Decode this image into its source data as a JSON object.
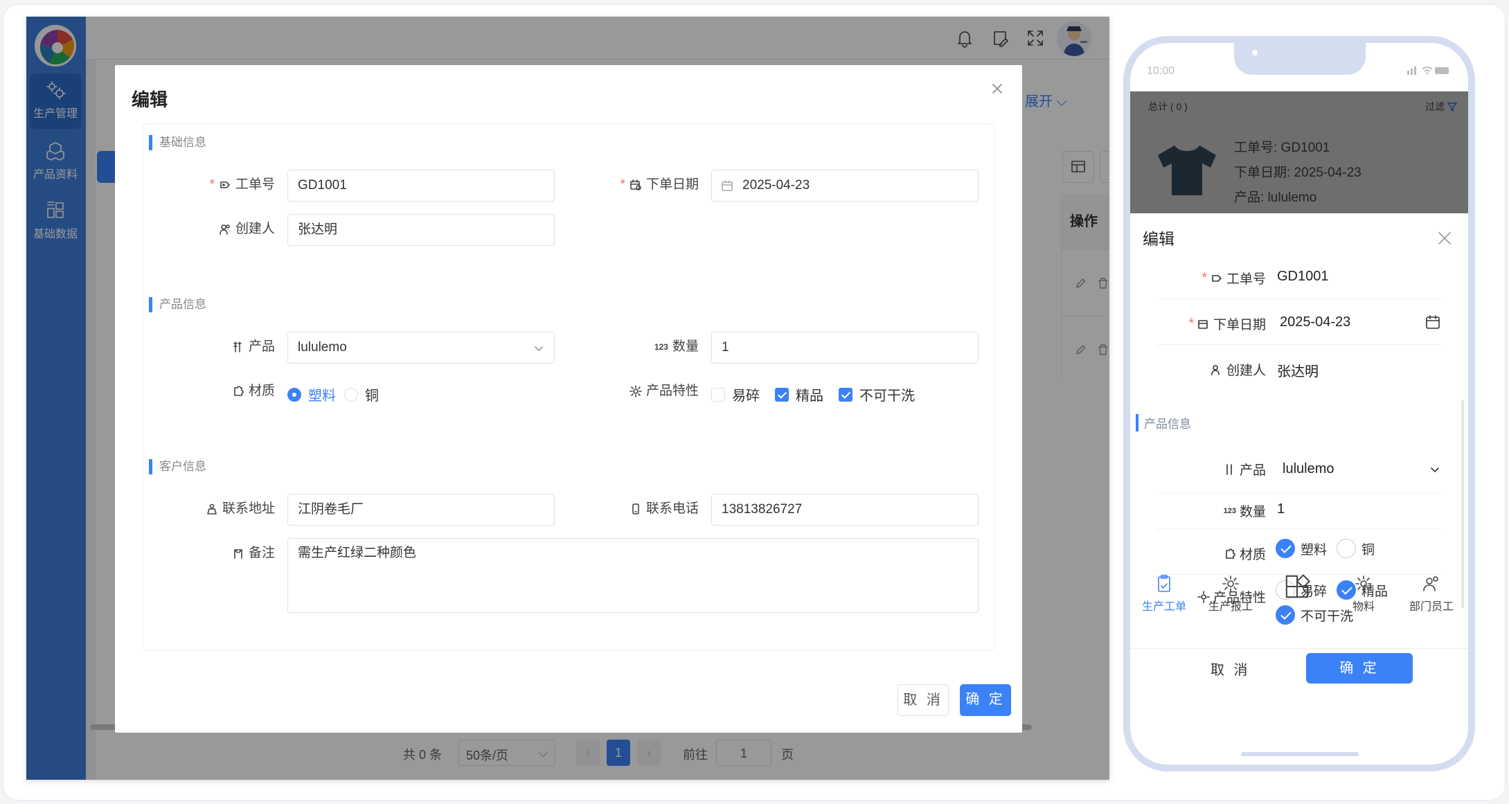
{
  "sidebar": {
    "items": [
      {
        "label": "生产管理",
        "icon": "gears-icon",
        "active": true
      },
      {
        "label": "产品资料",
        "icon": "cubes-icon",
        "active": false
      },
      {
        "label": "基础数据",
        "icon": "blocks-icon",
        "active": false
      }
    ]
  },
  "background": {
    "expand_label": "展开",
    "operate_header": "操作",
    "pagination": {
      "total": "共 0 条",
      "page_size": "50条/页",
      "current_page": "1",
      "goto_label": "前往",
      "goto_value": "1",
      "page_suffix": "页"
    }
  },
  "dialog": {
    "title": "编辑",
    "sections": {
      "basic": "基础信息",
      "product": "产品信息",
      "customer": "客户信息"
    },
    "fields": {
      "order_no": {
        "label": "工单号",
        "value": "GD1001"
      },
      "order_date": {
        "label": "下单日期",
        "value": "2025-04-23"
      },
      "creator": {
        "label": "创建人",
        "value": "张达明"
      },
      "product": {
        "label": "产品",
        "value": "lululemo"
      },
      "quantity": {
        "label": "数量",
        "value": "1"
      },
      "material": {
        "label": "材质",
        "options": [
          "塑料",
          "铜"
        ],
        "selected": "塑料"
      },
      "features": {
        "label": "产品特性",
        "options": [
          {
            "label": "易碎",
            "checked": false
          },
          {
            "label": "精品",
            "checked": true
          },
          {
            "label": "不可干洗",
            "checked": true
          }
        ]
      },
      "address": {
        "label": "联系地址",
        "value": "江阴卷毛厂"
      },
      "phone": {
        "label": "联系电话",
        "value": "13813826727"
      },
      "remark": {
        "label": "备注",
        "value": "需生产红绿二种颜色"
      }
    },
    "cancel_label": "取 消",
    "confirm_label": "确 定"
  },
  "mobile": {
    "time": "10:00",
    "total": "总计 ( 0 )",
    "filter": "过滤",
    "card": {
      "order_no": "工单号: GD1001",
      "order_date": "下单日期: 2025-04-23",
      "product": "产品: lululemo"
    },
    "sheet": {
      "title": "编辑",
      "order_no_label": "工单号",
      "order_no": "GD1001",
      "order_date_label": "下单日期",
      "order_date": "2025-04-23",
      "creator_label": "创建人",
      "creator": "张达明",
      "section_product": "产品信息",
      "product_label": "产品",
      "product": "lululemo",
      "quantity_label": "数量",
      "quantity": "1",
      "material_label": "材质",
      "material_options": [
        "塑料",
        "铜"
      ],
      "features_label": "产品特性",
      "features": [
        "易碎",
        "精品",
        "不可干洗"
      ],
      "cancel": "取 消",
      "confirm": "确 定"
    },
    "tabs": [
      {
        "label": "生产工单",
        "icon": "clipboard-icon",
        "active": true
      },
      {
        "label": "生产报工",
        "icon": "sun-icon",
        "active": false
      },
      {
        "label": "",
        "icon": "shapes-icon",
        "active": false
      },
      {
        "label": "物料",
        "icon": "sun-icon",
        "active": false
      },
      {
        "label": "部门员工",
        "icon": "users-icon",
        "active": false
      }
    ]
  },
  "colors": {
    "primary": "#3b82f6",
    "sidebar": "#3f7fd9",
    "required": "#f56c6c"
  }
}
